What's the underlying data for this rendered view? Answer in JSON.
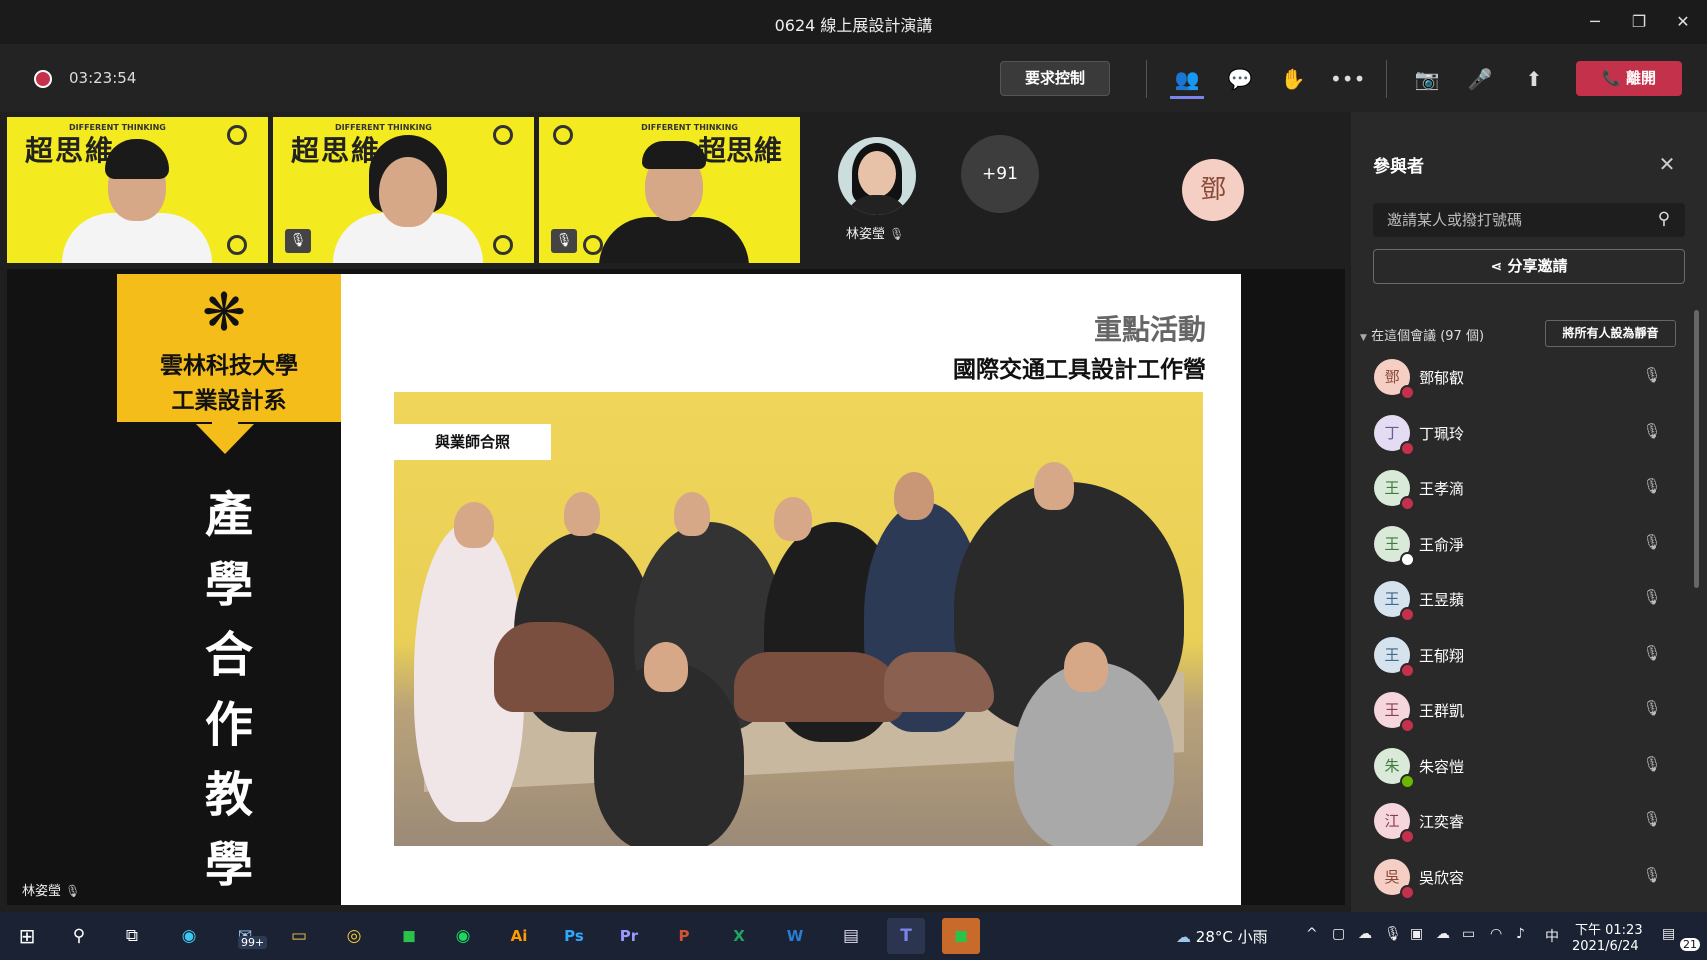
{
  "window": {
    "title": "0624 線上展設計演講",
    "minimize": "─",
    "restore": "❐",
    "close": "✕"
  },
  "toolbar": {
    "timer": "03:23:54",
    "request_control": "要求控制",
    "people_icon": "👥",
    "chat_icon": "💬",
    "reactions_icon": "✋",
    "more_icon": "•••",
    "camera_icon": "📷",
    "mic_icon": "🎤",
    "share_icon": "⬆",
    "leave_label": "離開",
    "leave_icon": "📞"
  },
  "video_strip": {
    "tiles": [
      {
        "bg_text": "超思維",
        "small_text": "DIFFERENT THINKING"
      },
      {
        "bg_text": "超思維",
        "small_text": "DIFFERENT THINKING"
      },
      {
        "bg_text": "超思維",
        "small_text": "DIFFERENT THINKING"
      }
    ],
    "presenter_name": "林姿瑩",
    "overflow_count": "+91",
    "deng_initial": "鄧"
  },
  "slide": {
    "university": "雲林科技大學",
    "department": "工業設計系",
    "vertical_chars": [
      "產",
      "學",
      "合",
      "作",
      "教",
      "學"
    ],
    "kicker": "重點活動",
    "title": "國際交通工具設計工作營",
    "photo_caption": "與業師合照",
    "presenter_label": "林姿瑩"
  },
  "panel": {
    "title": "參與者",
    "search_placeholder": "邀請某人或撥打號碼",
    "share_invite": "分享邀請",
    "section_label": "在這個會議 (97 個)",
    "mute_all": "將所有人設為靜音",
    "participants": [
      {
        "initial": "鄧",
        "name": "鄧郁叡",
        "avatar_bg": "#f5cfc3",
        "avatar_fg": "#8a4a3a",
        "status": "#c4314b"
      },
      {
        "initial": "丁",
        "name": "丁珮玲",
        "avatar_bg": "#e4dcf2",
        "avatar_fg": "#6b5a94",
        "status": "#c4314b"
      },
      {
        "initial": "王",
        "name": "王孝滴",
        "avatar_bg": "#d9ead9",
        "avatar_fg": "#3f7a3f",
        "status": "#c4314b"
      },
      {
        "initial": "王",
        "name": "王俞淨",
        "avatar_bg": "#d9ead9",
        "avatar_fg": "#3f7a3f",
        "status": "#ffffff"
      },
      {
        "initial": "王",
        "name": "王昱蘋",
        "avatar_bg": "#d6e3ee",
        "avatar_fg": "#3f6a8a",
        "status": "#c4314b"
      },
      {
        "initial": "王",
        "name": "王郁翔",
        "avatar_bg": "#d6e3ee",
        "avatar_fg": "#3f6a8a",
        "status": "#c4314b"
      },
      {
        "initial": "王",
        "name": "王群凱",
        "avatar_bg": "#f5d6dc",
        "avatar_fg": "#8a3f4f",
        "status": "#c4314b"
      },
      {
        "initial": "朱",
        "name": "朱容愷",
        "avatar_bg": "#d9ead9",
        "avatar_fg": "#3f7a3f",
        "status": "#6bb700"
      },
      {
        "initial": "江",
        "name": "江奕睿",
        "avatar_bg": "#f5d6dc",
        "avatar_fg": "#8a3f4f",
        "status": "#c4314b"
      },
      {
        "initial": "吳",
        "name": "吳欣容",
        "avatar_bg": "#f5cfc3",
        "avatar_fg": "#8a4a3a",
        "status": "#c4314b"
      }
    ]
  },
  "taskbar": {
    "badge_99": "99+",
    "weather": "28°C  小雨",
    "ime": "中",
    "time": "下午 01:23",
    "date": "2021/6/24",
    "notif_count": "21"
  }
}
